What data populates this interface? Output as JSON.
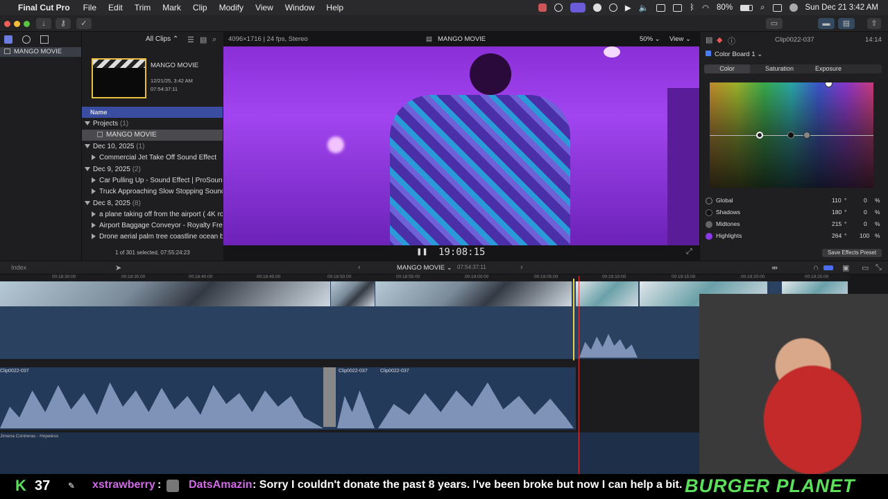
{
  "menubar": {
    "app": "Final Cut Pro",
    "items": [
      "File",
      "Edit",
      "Trim",
      "Mark",
      "Clip",
      "Modify",
      "View",
      "Window",
      "Help"
    ],
    "battery": "80%",
    "datetime": "Sun Dec 21  3:42 AM"
  },
  "library": {
    "name": "MANGO MOVIE"
  },
  "browser": {
    "filter": "All Clips",
    "project_thumb_title": "MANGO MOVIE",
    "project_date": "12/21/25, 3:42 AM",
    "project_duration": "07:54:37:11",
    "column_name": "Name",
    "groups": [
      {
        "label": "Projects",
        "count": "(1)",
        "items": [
          "MANGO MOVIE"
        ]
      },
      {
        "label": "Dec 10, 2025",
        "count": "(1)",
        "items": [
          "Commercial Jet Take Off Sound Effect"
        ]
      },
      {
        "label": "Dec 9, 2025",
        "count": "(2)",
        "items": [
          "Car Pulling Up - Sound Effect  |  ProSoun",
          "Truck Approaching Slow Stopping Sound"
        ]
      },
      {
        "label": "Dec 8, 2025",
        "count": "(8)",
        "items": [
          "a plane taking off from the airport ( 4K ro",
          "Airport Baggage Conveyor - Royalty Free",
          "Drone aerial palm tree coastline ocean be"
        ]
      }
    ],
    "selection": "1 of 301 selected, 07:55:24:23"
  },
  "viewer": {
    "format": "4096×1716 | 24 fps, Stereo",
    "title": "MANGO MOVIE",
    "zoom": "50%",
    "view_label": "View",
    "timecode": "19:08:15"
  },
  "inspector": {
    "clip": "Clip0022-037",
    "duration": "14:14",
    "board": "Color Board 1",
    "tabs": [
      "Color",
      "Saturation",
      "Exposure"
    ],
    "rows": [
      {
        "label": "Global",
        "angle": "110",
        "pct": "0"
      },
      {
        "label": "Shadows",
        "angle": "180",
        "pct": "0"
      },
      {
        "label": "Midtones",
        "angle": "215",
        "pct": "0"
      },
      {
        "label": "Highlights",
        "angle": "264",
        "pct": "100"
      }
    ],
    "save_preset": "Save Effects Preset"
  },
  "timeline_bar": {
    "index": "Index",
    "project": "MANGO MOVIE",
    "duration": "07:54:37:11"
  },
  "timeline": {
    "ruler": [
      "00:18:30:00",
      "00:18:35:00",
      "00:18:40:00",
      "00:18:45:00",
      "00:18:50:00",
      "00:18:55:00",
      "00:19:00:00",
      "00:19:05:00",
      "00:19:10:00",
      "00:19:15:00",
      "00:19:20:00",
      "00:19:25:00"
    ],
    "audio_clips": [
      "Clip0022-037",
      "Clip0022-037",
      "Clip0022-037"
    ],
    "music_label": "Jimena Contreras - Hopeless"
  },
  "stream": {
    "count": "37",
    "user": "xstrawberry",
    "donor": "DatsAmazin",
    "message": ": Sorry I couldn't donate the past 8 years. I've been broke but now I can help a bit.",
    "brand": "BURGER PLANET"
  }
}
